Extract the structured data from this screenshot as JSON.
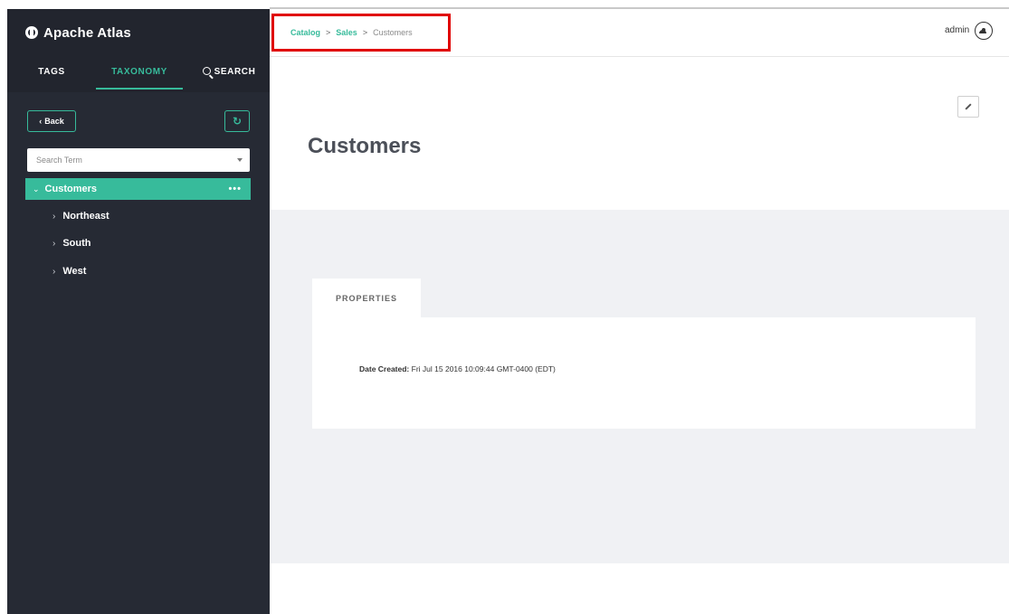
{
  "brand": {
    "title": "Apache Atlas",
    "icon": "globe-icon"
  },
  "tabs": [
    {
      "label": "TAGS"
    },
    {
      "label": "TAXONOMY",
      "active": true
    },
    {
      "label": "SEARCH"
    }
  ],
  "sidebar": {
    "back_label": "Back",
    "search_placeholder": "Search Term",
    "tree": {
      "selected": {
        "label": "Customers",
        "more": "•••"
      },
      "children": [
        {
          "label": "Northeast"
        },
        {
          "label": "South"
        },
        {
          "label": "West"
        }
      ]
    }
  },
  "breadcrumb": {
    "items": [
      "Catalog",
      "Sales",
      "Customers"
    ],
    "separator": ">"
  },
  "user": {
    "name": "admin"
  },
  "page": {
    "title": "Customers"
  },
  "properties": {
    "tab_label": "PROPERTIES",
    "date_created_key": "Date Created:",
    "date_created_value": "Fri Jul 15 2016 10:09:44 GMT-0400 (EDT)"
  },
  "colors": {
    "accent": "#37bb9b",
    "sidebar_bg": "#262a34",
    "highlight_box": "#e00000"
  }
}
